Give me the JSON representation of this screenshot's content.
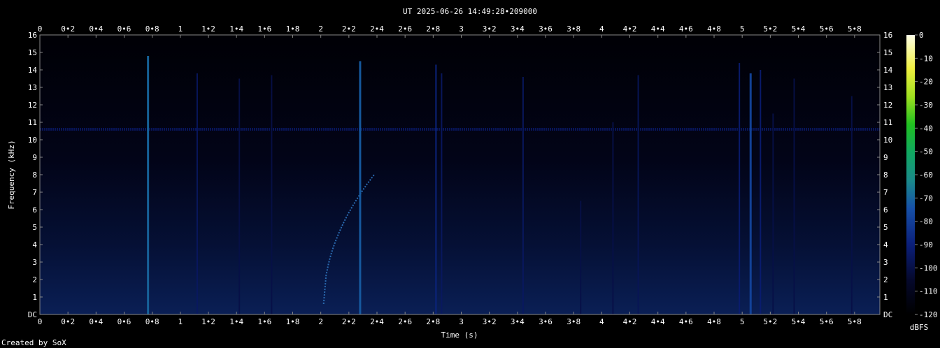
{
  "chart_data": {
    "type": "heatmap",
    "title": "UT 2025-06-26 14:49:28•209000",
    "xlabel": "Time (s)",
    "ylabel": "Frequency (kHz)",
    "xlim": [
      0,
      5.98
    ],
    "ylim": [
      0,
      16
    ],
    "x_ticks": [
      "0",
      "0•2",
      "0•4",
      "0•6",
      "0•8",
      "1",
      "1•2",
      "1•4",
      "1•6",
      "1•8",
      "2",
      "2•2",
      "2•4",
      "2•6",
      "2•8",
      "3",
      "3•2",
      "3•4",
      "3•6",
      "3•8",
      "4",
      "4•2",
      "4•4",
      "4•6",
      "4•8",
      "5",
      "5•2",
      "5•4",
      "5•6",
      "5•8"
    ],
    "y_ticks": [
      "DC",
      "1",
      "2",
      "3",
      "4",
      "5",
      "6",
      "7",
      "8",
      "9",
      "10",
      "11",
      "12",
      "13",
      "14",
      "15",
      "16"
    ],
    "colorbar": {
      "label": "dBFS",
      "ticks": [
        "0",
        "-10",
        "-20",
        "-30",
        "-40",
        "-50",
        "-60",
        "-70",
        "-80",
        "-90",
        "-100",
        "-110",
        "-120"
      ],
      "range": [
        -120,
        0
      ]
    },
    "tone_line": {
      "freq_khz": 10.6,
      "level_dbfs": -95
    },
    "chirp": {
      "t_start": 2.02,
      "f_start": 0.6,
      "t_end": 2.38,
      "f_end": 8.0
    },
    "events": [
      {
        "t": 0.77,
        "top_khz": 14.8,
        "level_dbfs": -70
      },
      {
        "t": 1.12,
        "top_khz": 13.8,
        "level_dbfs": -95
      },
      {
        "t": 1.42,
        "top_khz": 13.5,
        "level_dbfs": -100
      },
      {
        "t": 1.65,
        "top_khz": 13.7,
        "level_dbfs": -100
      },
      {
        "t": 2.28,
        "top_khz": 14.5,
        "level_dbfs": -72
      },
      {
        "t": 2.82,
        "top_khz": 14.3,
        "level_dbfs": -88
      },
      {
        "t": 2.86,
        "top_khz": 13.8,
        "level_dbfs": -95
      },
      {
        "t": 3.44,
        "top_khz": 13.6,
        "level_dbfs": -95
      },
      {
        "t": 3.85,
        "top_khz": 6.5,
        "level_dbfs": -100
      },
      {
        "t": 4.08,
        "top_khz": 11.0,
        "level_dbfs": -100
      },
      {
        "t": 4.26,
        "top_khz": 13.7,
        "level_dbfs": -97
      },
      {
        "t": 4.98,
        "top_khz": 14.4,
        "level_dbfs": -92
      },
      {
        "t": 5.06,
        "top_khz": 13.8,
        "level_dbfs": -78
      },
      {
        "t": 5.13,
        "top_khz": 14.0,
        "level_dbfs": -92
      },
      {
        "t": 5.22,
        "top_khz": 11.5,
        "level_dbfs": -100
      },
      {
        "t": 5.37,
        "top_khz": 13.5,
        "level_dbfs": -100
      },
      {
        "t": 5.78,
        "top_khz": 12.5,
        "level_dbfs": -100
      }
    ]
  },
  "footer": {
    "credit": "Created by SoX"
  }
}
